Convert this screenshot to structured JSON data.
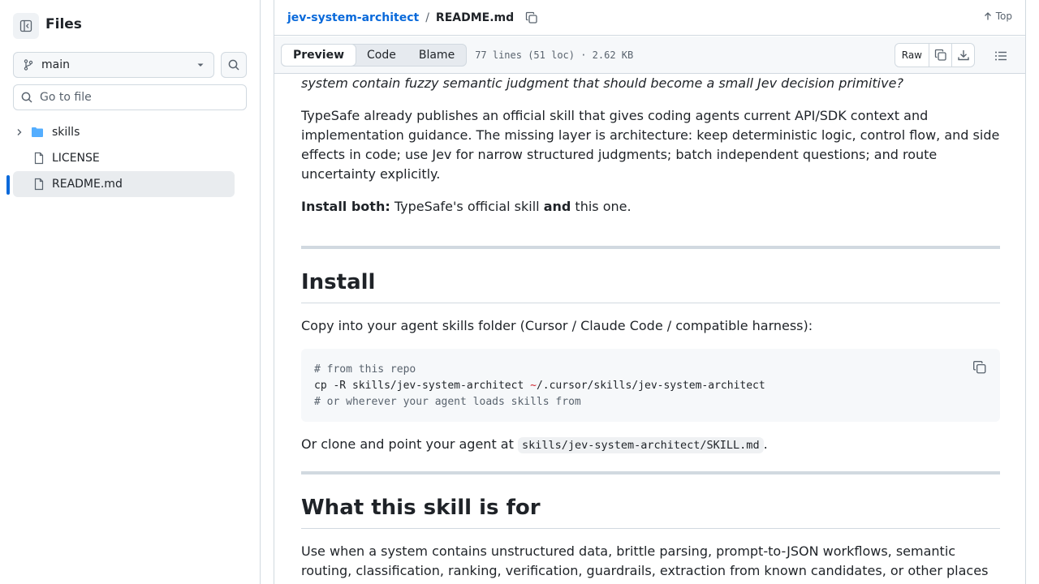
{
  "sidebar": {
    "title": "Files",
    "branch": "main",
    "search_placeholder": "Go to file",
    "items": [
      {
        "label": "skills",
        "type": "folder"
      },
      {
        "label": "LICENSE",
        "type": "file"
      },
      {
        "label": "README.md",
        "type": "file",
        "active": true
      }
    ]
  },
  "header": {
    "repo": "jev-system-architect",
    "separator": "/",
    "file": "README.md",
    "top_label": "Top"
  },
  "toolbar": {
    "tabs": [
      "Preview",
      "Code",
      "Blame"
    ],
    "active_tab": "Preview",
    "meta": "77 lines (51 loc) · 2.62 KB",
    "raw_label": "Raw"
  },
  "content": {
    "lead": "system contain fuzzy semantic judgment that should become a small Jev decision primitive?",
    "p1": "TypeSafe already publishes an official skill that gives coding agents current API/SDK context and implementation guidance. The missing layer is architecture: keep deterministic logic, control flow, and side effects in code; use Jev for narrow structured judgments; batch independent questions; and route uncertainty explicitly.",
    "p2_strong": "Install both:",
    "p2_mid": " TypeSafe's official skill ",
    "p2_strong2": "and",
    "p2_end": " this one.",
    "h_install": "Install",
    "p3": "Copy into your agent skills folder (Cursor / Claude Code / compatible harness):",
    "code_line1": "# from this repo",
    "code_line2_a": "cp -R skills/jev-system-architect ",
    "code_line2_tilde": "~",
    "code_line2_b": "/.cursor/skills/jev-system-architect",
    "code_line3": "# or wherever your agent loads skills from",
    "p4_a": "Or clone and point your agent at ",
    "p4_code": "skills/jev-system-architect/SKILL.md",
    "p4_b": ".",
    "h_what": "What this skill is for",
    "p5": "Use when a system contains unstructured data, brittle parsing, prompt-to-JSON workflows, semantic routing, classification, ranking, verification, guardrails, extraction from known candidates, or other places where deterministic code needs bounded human-like judgment."
  },
  "colors": {
    "link": "#0969da",
    "active_bar": "#0969da",
    "folder": "#54aeff"
  }
}
